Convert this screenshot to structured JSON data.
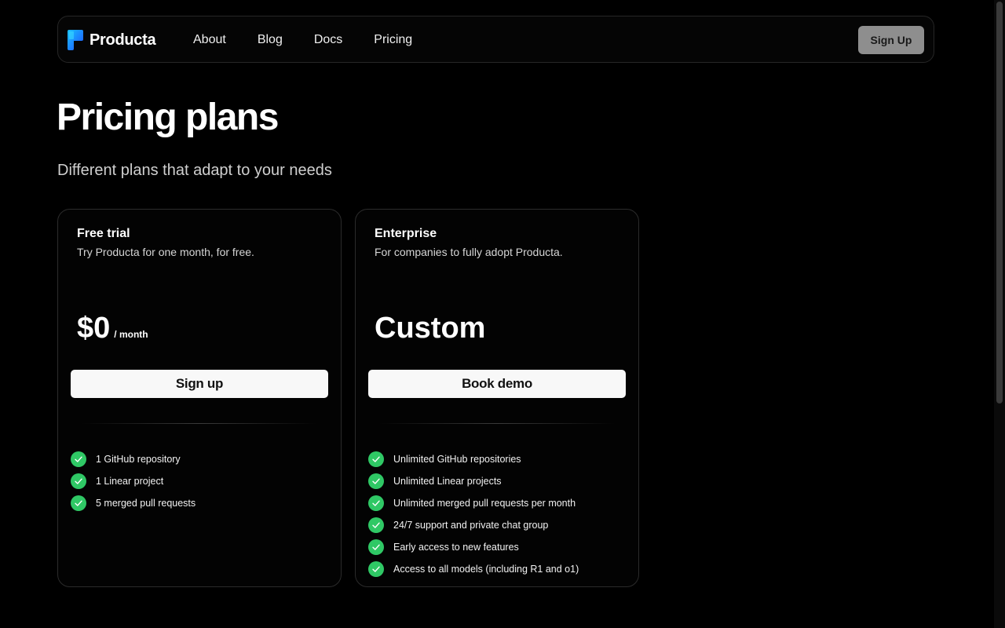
{
  "brand": {
    "name": "Producta"
  },
  "nav": {
    "links": [
      {
        "label": "About"
      },
      {
        "label": "Blog"
      },
      {
        "label": "Docs"
      },
      {
        "label": "Pricing"
      }
    ],
    "signup_label": "Sign Up"
  },
  "hero": {
    "title": "Pricing plans",
    "subtitle": "Different plans that adapt to your needs"
  },
  "plans": [
    {
      "name": "Free trial",
      "description": "Try Producta for one month, for free.",
      "price": "$0",
      "period": "/ month",
      "cta": "Sign up",
      "features": [
        "1 GitHub repository",
        "1 Linear project",
        "5 merged pull requests"
      ]
    },
    {
      "name": "Enterprise",
      "description": "For companies to fully adopt Producta.",
      "price": "Custom",
      "period": "",
      "cta": "Book demo",
      "features": [
        "Unlimited GitHub repositories",
        "Unlimited Linear projects",
        "Unlimited merged pull requests per month",
        "24/7 support and private chat group",
        "Early access to new features",
        "Access to all models (including R1 and o1)"
      ]
    }
  ],
  "icons": {
    "logo": "producta-logo-icon",
    "feature": "check-circle-icon"
  },
  "colors": {
    "background": "#000000",
    "check": "#2fc865",
    "signup_button": "#8e8e8e",
    "cta_button": "#f8f8f8",
    "logo_gradient_start": "#1e6bff",
    "logo_gradient_end": "#19c2ff"
  }
}
